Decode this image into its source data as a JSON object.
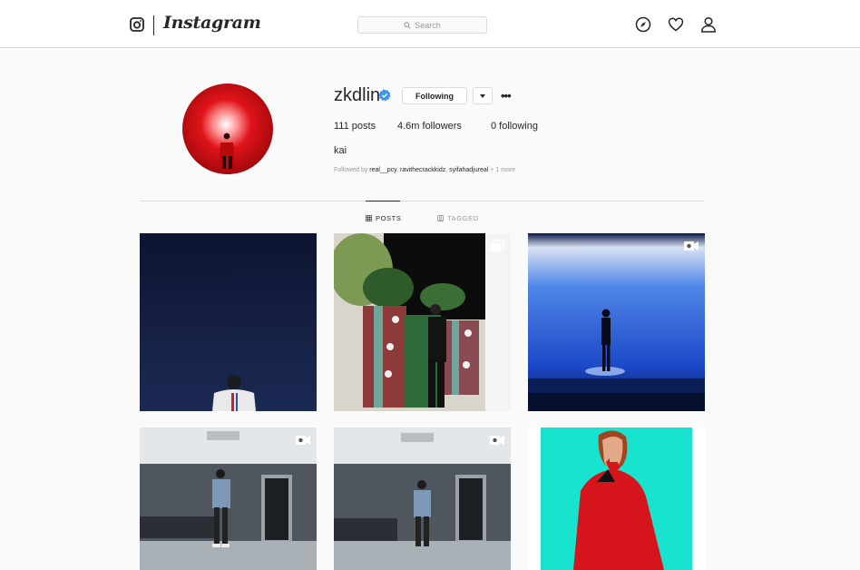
{
  "header": {
    "logo_text": "Instagram",
    "search": {
      "placeholder": "Search"
    },
    "icons": [
      "camera-icon",
      "compass-icon",
      "heart-icon",
      "person-icon"
    ]
  },
  "profile": {
    "username": "zkdlin",
    "verified": true,
    "follow_label": "Following",
    "more_label": "•••",
    "stats": {
      "posts": "111 posts",
      "followers": "4.6m followers",
      "following": "0 following"
    },
    "full_name": "kai",
    "followed_by": {
      "prefix": "Followed by ",
      "names": [
        "real__pcy",
        "ravithecrackkidz",
        "syifahadjureal"
      ],
      "sep1": ", ",
      "sep2": ", ",
      "suffix": " + 1 more"
    }
  },
  "tabs": [
    {
      "label": "POSTS",
      "active": true
    },
    {
      "label": "TAGGED",
      "active": false
    }
  ],
  "posts": [
    {
      "kind": "night-sky",
      "media": "none"
    },
    {
      "kind": "christmas-gifts",
      "media": "carousel"
    },
    {
      "kind": "blue-stage",
      "media": "video"
    },
    {
      "kind": "dance-studio",
      "media": "video"
    },
    {
      "kind": "dance-studio",
      "media": "video"
    },
    {
      "kind": "red-suit-portrait",
      "media": "none"
    }
  ],
  "colors": {
    "accent_blue": "#3897f0",
    "border": "#dbdbdb",
    "text": "#262626",
    "muted": "#999999",
    "background": "#fafafa"
  }
}
